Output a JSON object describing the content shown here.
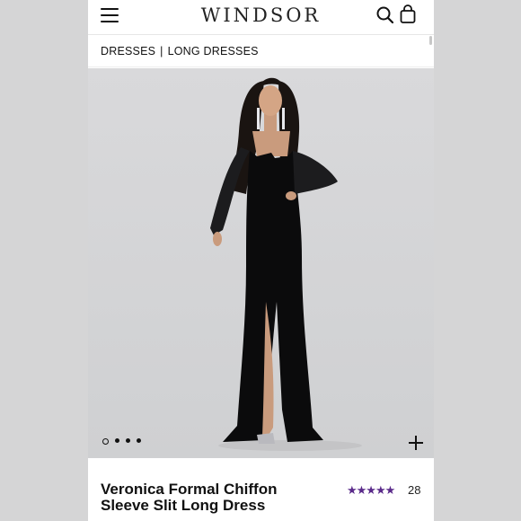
{
  "brand": {
    "logo": "WINDSOR"
  },
  "breadcrumb": {
    "items": [
      "DRESSES",
      "LONG DRESSES"
    ],
    "separator": "|"
  },
  "gallery": {
    "slide_count": 4,
    "active_index": 0
  },
  "product": {
    "title": "Veronica Formal Chiffon Sleeve Slit Long Dress",
    "rating_value": 5,
    "rating_max": 5,
    "stars": "★★★★★",
    "rating_count": "28"
  },
  "icons": {
    "menu": "hamburger-menu-icon",
    "search": "search-icon",
    "bag": "shopping-bag-icon",
    "zoom": "plus-icon"
  },
  "colors": {
    "accent": "#5a2a8a",
    "text": "#111111",
    "backdrop": "#d5d5d6"
  }
}
